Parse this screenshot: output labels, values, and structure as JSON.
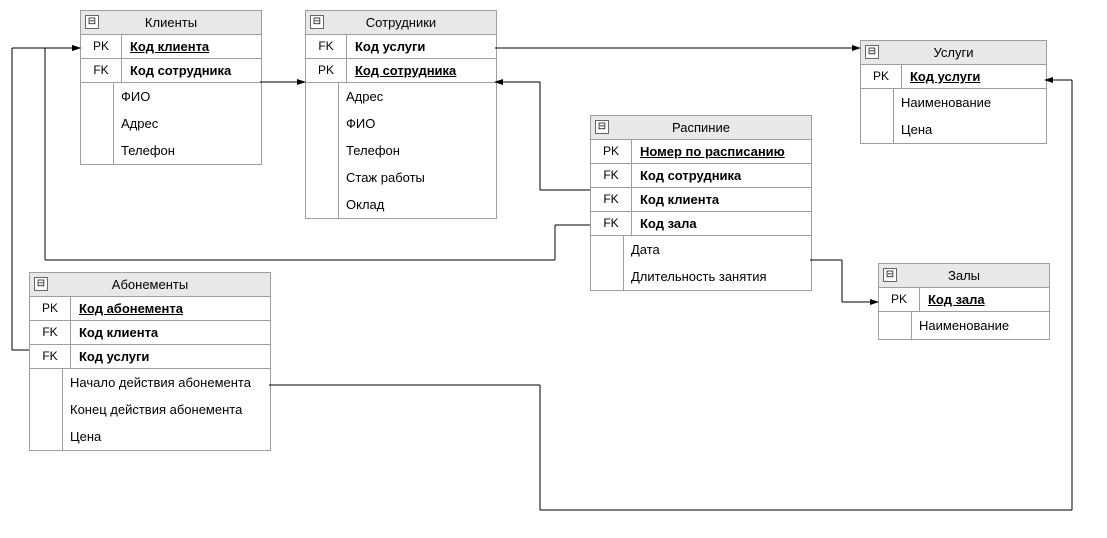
{
  "entities": {
    "clients": {
      "title": "Клиенты",
      "rows": [
        {
          "key": "PK",
          "label": "Код клиента",
          "bold": true,
          "ul": true
        },
        {
          "key": "FK",
          "label": "Код сотрудника",
          "bold": true
        }
      ],
      "plain": [
        "ФИО",
        "Адрес",
        "Телефон"
      ]
    },
    "employees": {
      "title": "Сотрудники",
      "rows": [
        {
          "key": "FK",
          "label": "Код услуги",
          "bold": true
        },
        {
          "key": "PK",
          "label": "Код сотрудника",
          "bold": true,
          "ul": true
        }
      ],
      "plain": [
        "Адрес",
        "ФИО",
        "Телефон",
        "Стаж работы",
        "Оклад"
      ]
    },
    "services": {
      "title": "Услуги",
      "rows": [
        {
          "key": "PK",
          "label": "Код услуги",
          "bold": true,
          "ul": true
        }
      ],
      "plain": [
        "Наименование",
        "Цена"
      ]
    },
    "schedule": {
      "title": "Распиние",
      "rows": [
        {
          "key": "PK",
          "label": "Номер по расписанию",
          "bold": true,
          "ul": true
        },
        {
          "key": "FK",
          "label": "Код сотрудника",
          "bold": true
        },
        {
          "key": "FK",
          "label": "Код клиента",
          "bold": true
        },
        {
          "key": "FK",
          "label": "Код зала",
          "bold": true
        }
      ],
      "plain": [
        "Дата",
        "Длительность занятия"
      ]
    },
    "subscriptions": {
      "title": "Абонементы",
      "rows": [
        {
          "key": "PK",
          "label": "Код абонемента",
          "bold": true,
          "ul": true
        },
        {
          "key": "FK",
          "label": "Код клиента",
          "bold": true
        },
        {
          "key": "FK",
          "label": "Код услуги",
          "bold": true
        }
      ],
      "plain": [
        "Начало действия абонемента",
        "Конец действия абонемента",
        "Цена"
      ]
    },
    "halls": {
      "title": "Залы",
      "rows": [
        {
          "key": "PK",
          "label": "Код зала",
          "bold": true,
          "ul": true
        }
      ],
      "plain": [
        "Наименование"
      ]
    }
  },
  "collapse_glyph": "⊟"
}
